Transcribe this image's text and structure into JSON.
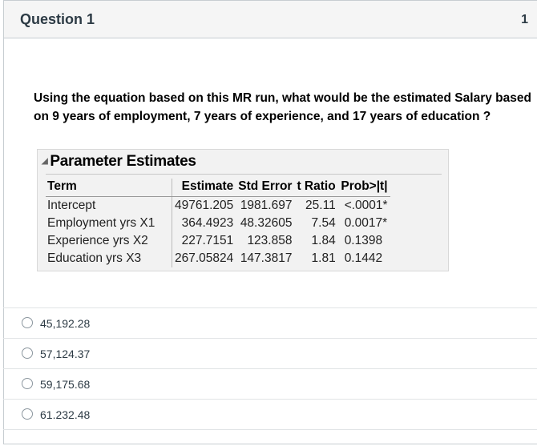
{
  "question": {
    "title": "Question 1",
    "points": "1",
    "text": "Using the equation based on this MR run, what would be the estimated Salary based on 9 years of employment, 7 years of experience, and 17 years of education ?"
  },
  "table": {
    "title": "Parameter Estimates",
    "headers": [
      "Term",
      "Estimate",
      "Std Error",
      "t Ratio",
      "Prob>|t|"
    ],
    "rows": [
      [
        "Intercept",
        "49761.205",
        "1981.697",
        "25.11",
        "<.0001*"
      ],
      [
        "Employment yrs X1",
        "364.4923",
        "48.32605",
        "7.54",
        "0.0017*"
      ],
      [
        "Experience yrs X2",
        "227.7151",
        "123.858",
        "1.84",
        "0.1398"
      ],
      [
        "Education yrs X3",
        "267.05824",
        "147.3817",
        "1.81",
        "0.1442"
      ]
    ]
  },
  "answers": [
    "45,192.28",
    "57,124.37",
    "59,175.68",
    "61.232.48"
  ],
  "colors": {
    "significant": "#e0762a",
    "header_bg": "#f5f5f5",
    "border": "#c7cdd1"
  }
}
